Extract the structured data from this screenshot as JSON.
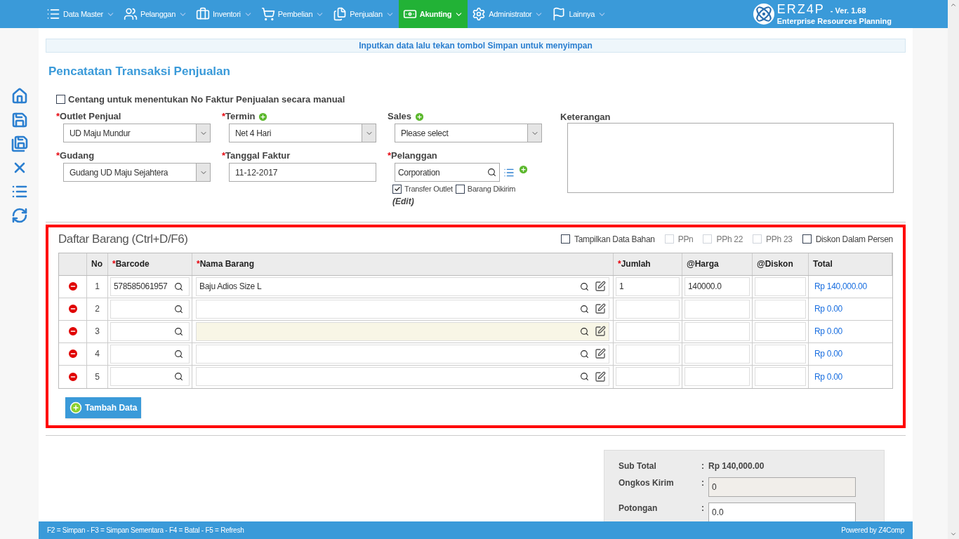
{
  "nav": {
    "items": [
      {
        "label": "Data Master",
        "selected": false
      },
      {
        "label": "Pelanggan",
        "selected": false
      },
      {
        "label": "Inventori",
        "selected": false
      },
      {
        "label": "Pembelian",
        "selected": false
      },
      {
        "label": "Penjualan",
        "selected": false
      },
      {
        "label": "Akunting",
        "selected": true
      },
      {
        "label": "Administrator",
        "selected": false
      },
      {
        "label": "Lainnya",
        "selected": false
      }
    ],
    "brand": {
      "name": "ERZ4P",
      "version": "- Ver. 1.68",
      "tagline": "Enterprise Resources Planning"
    }
  },
  "notice": "Inputkan data lalu tekan tombol Simpan untuk menyimpan",
  "title": "Pencatatan Transaksi Penjualan",
  "manual_checkbox": {
    "label": "Centang untuk menentukan No Faktur Penjualan secara manual",
    "checked": false
  },
  "form": {
    "columns": [
      [
        {
          "mark": "*",
          "label": "Outlet Penjual",
          "add": false,
          "kind": "select",
          "value": "UD Maju Mundur"
        },
        {
          "mark": "*",
          "label": "Gudang",
          "add": false,
          "kind": "select",
          "value": "Gudang UD Maju Sejahtera"
        }
      ],
      [
        {
          "mark": "*",
          "label": "Termin",
          "add": true,
          "kind": "select",
          "value": "Net 4 Hari"
        },
        {
          "mark": "*",
          "label": "Tanggal Faktur",
          "add": false,
          "kind": "text",
          "value": "11-12-2017"
        }
      ],
      [
        {
          "label": "Sales",
          "add": true,
          "kind": "select",
          "value": "Please select"
        },
        {
          "mark": "*",
          "label": "Pelanggan",
          "add": false,
          "kind": "search",
          "value": "Corporation"
        }
      ]
    ],
    "pelanggan_options": [
      {
        "label": "Transfer Outlet",
        "checked": true
      },
      {
        "label": "Barang Dikirim",
        "checked": false
      }
    ],
    "edit_link": "(Edit)",
    "keterangan": {
      "label": "Keterangan"
    }
  },
  "items": {
    "title": "Daftar Barang (Ctrl+D/F6)",
    "options": [
      {
        "label": "Tampilkan Data Bahan",
        "checked": false,
        "disabled": false
      },
      {
        "label": "PPn",
        "checked": false,
        "disabled": true
      },
      {
        "label": "PPh 22",
        "checked": false,
        "disabled": true
      },
      {
        "label": "PPh 23",
        "checked": false,
        "disabled": true
      },
      {
        "label": "Diskon Dalam Persen",
        "checked": false,
        "disabled": false
      }
    ],
    "columns": [
      {
        "label": "No"
      },
      {
        "mark": "*",
        "label": "Barcode"
      },
      {
        "mark": "*",
        "label": "Nama Barang"
      },
      {
        "mark": "*",
        "label": "Jumlah"
      },
      {
        "label": "@Harga"
      },
      {
        "label": "@Diskon"
      },
      {
        "label": "Total"
      }
    ],
    "rows": [
      {
        "no": "1",
        "barcode": "578585061957",
        "name": "Baju Adios Size L",
        "jumlah": "1",
        "harga": "140000.0",
        "diskon": "",
        "total": "Rp 140,000.00",
        "focused": false
      },
      {
        "no": "2",
        "barcode": "",
        "name": "",
        "jumlah": "",
        "harga": "",
        "diskon": "",
        "total": "Rp 0.00",
        "focused": false
      },
      {
        "no": "3",
        "barcode": "",
        "name": "",
        "jumlah": "",
        "harga": "",
        "diskon": "",
        "total": "Rp 0.00",
        "focused": true
      },
      {
        "no": "4",
        "barcode": "",
        "name": "",
        "jumlah": "",
        "harga": "",
        "diskon": "",
        "total": "Rp 0.00",
        "focused": false
      },
      {
        "no": "5",
        "barcode": "",
        "name": "",
        "jumlah": "",
        "harga": "",
        "diskon": "",
        "total": "Rp 0.00",
        "focused": false
      }
    ],
    "add_button": "Tambah Data"
  },
  "summary": [
    {
      "label": "Sub Total",
      "colon": ":",
      "kind": "text",
      "value": "Rp 140,000.00"
    },
    {
      "label": "Ongkos Kirim",
      "colon": ":",
      "kind": "readonly",
      "value": "0"
    },
    {
      "label": "Potongan",
      "colon": ":",
      "kind": "input",
      "value": "0.0"
    }
  ],
  "footer": {
    "shortcuts": "F2 = Simpan - F3 = Simpan Sementara - F4 = Batal - F5 = Refresh",
    "powered": "Powered by Z4Comp"
  }
}
